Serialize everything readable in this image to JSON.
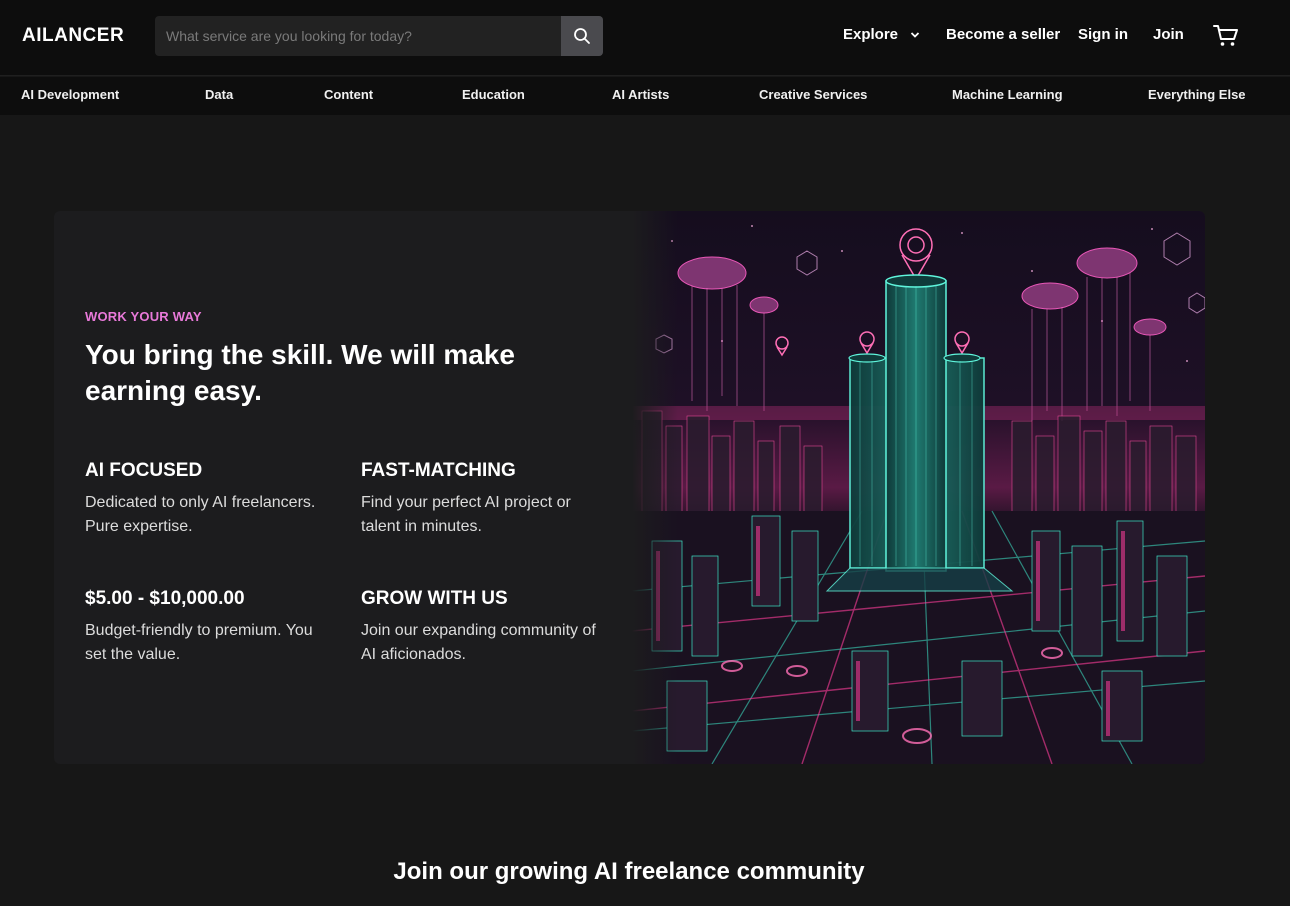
{
  "header": {
    "logo": "AILANCER",
    "search_placeholder": "What service are you looking for today?",
    "nav": {
      "explore": "Explore",
      "become_seller": "Become a seller",
      "sign_in": "Sign in",
      "join": "Join"
    }
  },
  "categories": [
    "AI Development",
    "Data",
    "Content",
    "Education",
    "AI Artists",
    "Creative Services",
    "Machine Learning",
    "Everything Else"
  ],
  "hero": {
    "eyebrow": "WORK YOUR WAY",
    "headline": "You bring the skill. We will make earning easy.",
    "features": [
      {
        "title": "AI FOCUSED",
        "text": "Dedicated to only AI freelancers. Pure expertise."
      },
      {
        "title": "FAST-MATCHING",
        "text": "Find your perfect AI project or talent in minutes."
      },
      {
        "title": "$5.00 - $10,000.00",
        "text": "Budget-friendly to premium. You set the value."
      },
      {
        "title": "GROW WITH US",
        "text": "Join our expanding community of AI aficionados."
      }
    ]
  },
  "community": {
    "title": "Join our growing AI freelance community"
  },
  "colors": {
    "accent_pink": "#e879d9",
    "neon_pink": "#ff3d9a",
    "neon_cyan": "#3ee6c8",
    "background": "#171717"
  },
  "icons": [
    "search-icon",
    "chevron-down-icon",
    "cart-icon"
  ]
}
